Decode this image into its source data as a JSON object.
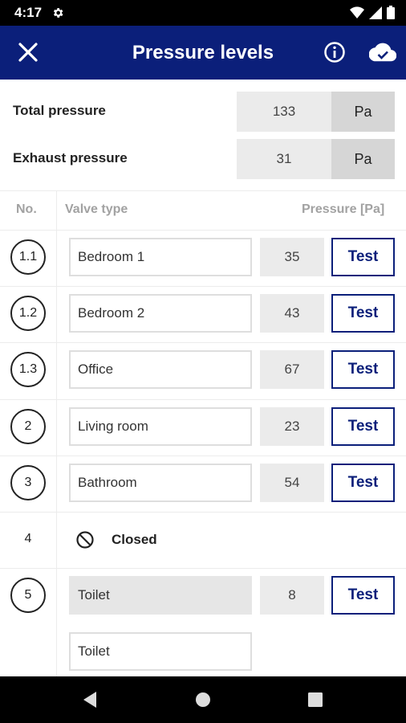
{
  "status_bar": {
    "time": "4:17"
  },
  "app_bar": {
    "title": "Pressure levels"
  },
  "summary": {
    "total_label": "Total pressure",
    "total_value": "133",
    "total_unit": "Pa",
    "exhaust_label": "Exhaust pressure",
    "exhaust_value": "31",
    "exhaust_unit": "Pa"
  },
  "table": {
    "headers": {
      "no": "No.",
      "valve_type": "Valve type",
      "pressure": "Pressure [Pa]"
    },
    "rows": [
      {
        "no": "1.1",
        "name": "Bedroom 1",
        "pressure": "35",
        "test": "Test"
      },
      {
        "no": "1.2",
        "name": "Bedroom 2",
        "pressure": "43",
        "test": "Test"
      },
      {
        "no": "1.3",
        "name": "Office",
        "pressure": "67",
        "test": "Test"
      },
      {
        "no": "2",
        "name": "Living room",
        "pressure": "23",
        "test": "Test"
      },
      {
        "no": "3",
        "name": "Bathroom",
        "pressure": "54",
        "test": "Test"
      },
      {
        "no": "4",
        "status": "Closed"
      },
      {
        "no": "5",
        "name": "Toilet",
        "pressure": "8",
        "test": "Test",
        "name_input": "Toilet"
      }
    ]
  },
  "colors": {
    "primary": "#0b1f7a",
    "status_bar": "#000000",
    "field_bg": "#ebebeb"
  }
}
